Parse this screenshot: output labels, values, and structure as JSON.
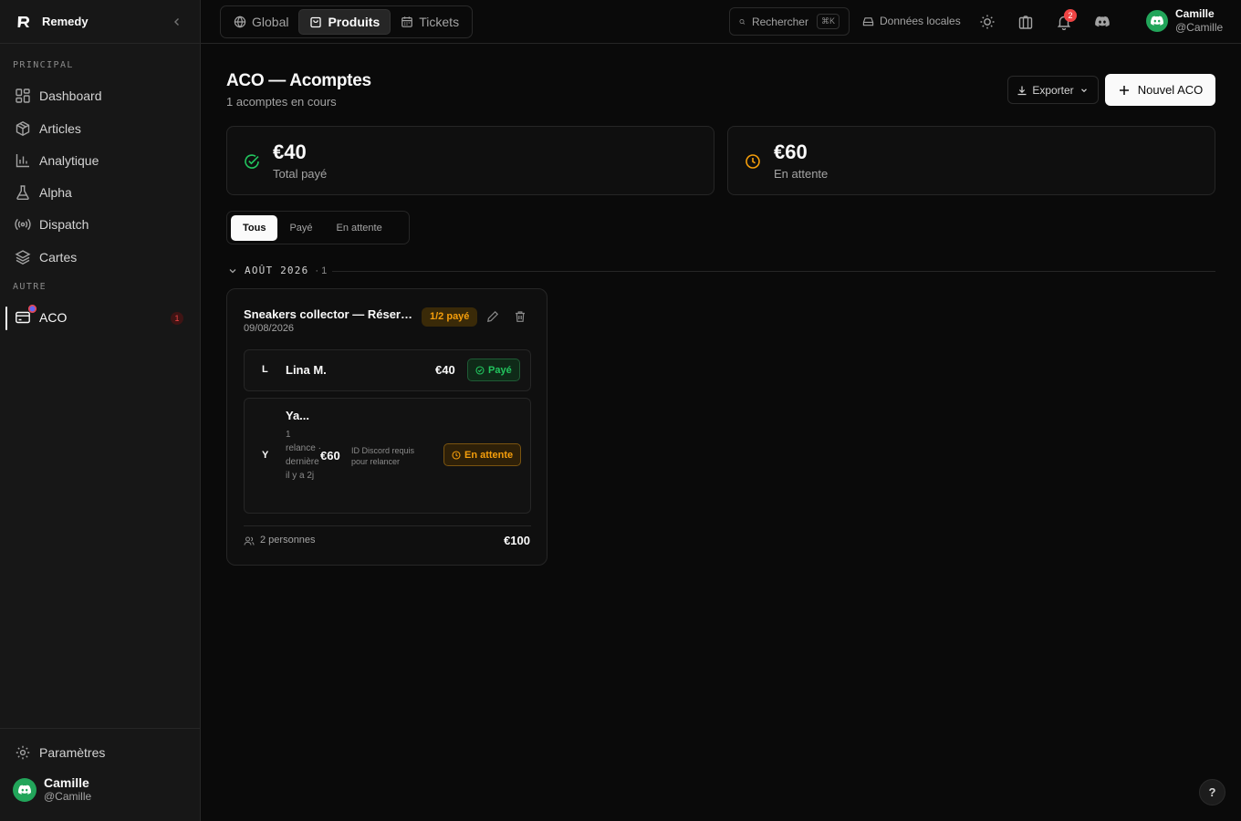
{
  "app": {
    "name": "Remedy"
  },
  "sidebar": {
    "section_principal": "PRINCIPAL",
    "section_autre": "AUTRE",
    "items": [
      {
        "label": "Dashboard",
        "icon": "dashboard-icon"
      },
      {
        "label": "Articles",
        "icon": "box-icon"
      },
      {
        "label": "Analytique",
        "icon": "bar-chart-icon"
      },
      {
        "label": "Alpha",
        "icon": "flask-icon"
      },
      {
        "label": "Dispatch",
        "icon": "broadcast-icon"
      },
      {
        "label": "Cartes",
        "icon": "layers-icon"
      }
    ],
    "aco": {
      "label": "ACO",
      "count": "1",
      "icon": "credit-card-icon"
    },
    "settings_label": "Paramètres",
    "user": {
      "name": "Camille",
      "handle": "@Camille"
    }
  },
  "topbar": {
    "tabs": [
      {
        "label": "Global",
        "icon": "globe-icon"
      },
      {
        "label": "Produits",
        "icon": "shopping-bag-icon"
      },
      {
        "label": "Tickets",
        "icon": "calendar-icon"
      }
    ],
    "search_label": "Rechercher",
    "search_shortcut": "⌘K",
    "local_data_label": "Données locales",
    "notification_count": "2",
    "user": {
      "name": "Camille",
      "handle": "@Camille"
    }
  },
  "page": {
    "title": "ACO — Acomptes",
    "subtitle": "1 acomptes en cours",
    "export_label": "Exporter",
    "new_label": "Nouvel ACO"
  },
  "stats": [
    {
      "value": "€40",
      "label": "Total payé",
      "color": "#22c55e"
    },
    {
      "value": "€60",
      "label": "En attente",
      "color": "#f59e0b"
    }
  ],
  "filters": [
    "Tous",
    "Payé",
    "En attente"
  ],
  "group": {
    "title": "AOÛT 2026",
    "count": "· 1"
  },
  "aco_card": {
    "title": "Sneakers collector — Réservation",
    "date": "09/08/2026",
    "badge": "1/2 payé",
    "people": [
      {
        "initial": "L",
        "name": "Lina M.",
        "amount": "€40",
        "status": "Payé"
      },
      {
        "initial": "Y",
        "name": "Ya...",
        "meta": "1 relance · dernière il y a 2j",
        "amount": "€60",
        "note": "ID Discord requis pour relancer",
        "status": "En attente"
      }
    ],
    "footer_people": "2 personnes",
    "footer_total": "€100"
  },
  "help_label": "?"
}
